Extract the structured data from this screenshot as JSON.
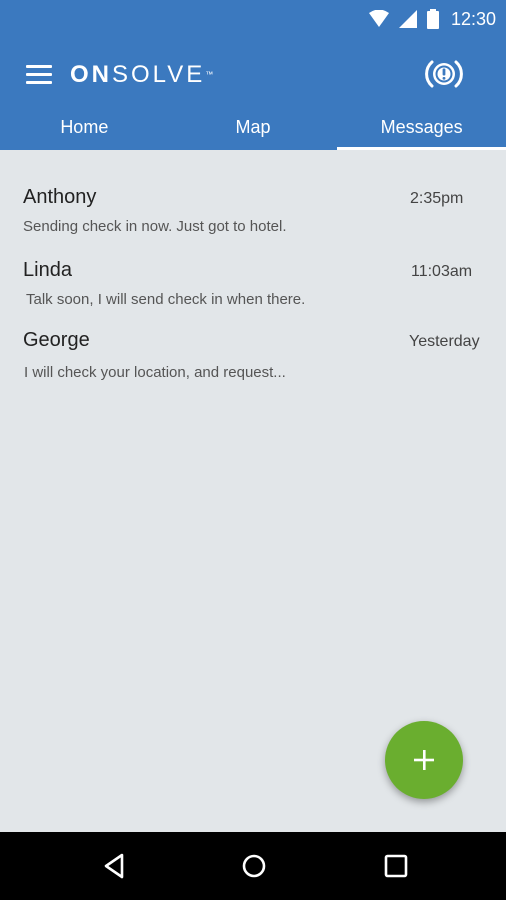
{
  "status_bar": {
    "time": "12:30",
    "icons": [
      "wifi-icon",
      "cell-signal-icon",
      "battery-icon"
    ]
  },
  "app_bar": {
    "menu_icon": "hamburger-menu-icon",
    "brand": {
      "on": "ON",
      "solve": "SOLVE",
      "tm": "™"
    },
    "action_icon": "alert-broadcast-icon"
  },
  "tabs": [
    {
      "label": "Home",
      "active": false
    },
    {
      "label": "Map",
      "active": false
    },
    {
      "label": "Messages",
      "active": true
    }
  ],
  "messages": [
    {
      "name": "Anthony",
      "time": "2:35pm",
      "preview": "Sending check in now. Just got to hotel."
    },
    {
      "name": "Linda",
      "time": "11:03am",
      "preview": "Talk soon, I will send check in when there."
    },
    {
      "name": "George",
      "time": "Yesterday",
      "preview": "I will check your location, and request..."
    }
  ],
  "fab": {
    "icon": "plus-icon"
  },
  "nav_bar": {
    "icons": [
      "back-icon",
      "home-icon",
      "recents-icon"
    ]
  },
  "colors": {
    "primary": "#3b79bf",
    "background": "#e2e6e9",
    "fab": "#6aae2f"
  }
}
